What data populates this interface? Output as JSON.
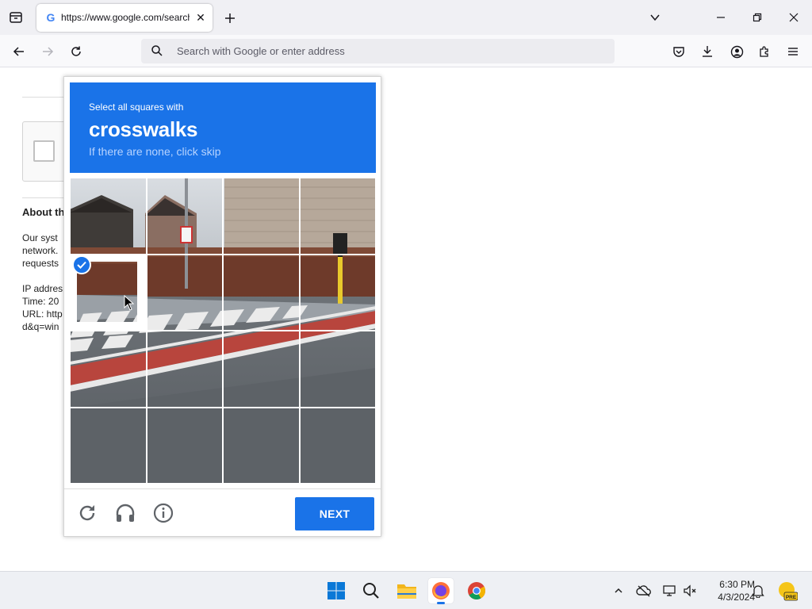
{
  "browser": {
    "tab": {
      "favicon": "G",
      "title": "https://www.google.com/search",
      "close_icon": "close-icon"
    },
    "new_tab_icon": "plus-icon",
    "urlbar": {
      "placeholder": "Search with Google or enter address",
      "icon": "search-icon"
    },
    "window_controls": [
      "minimize-icon",
      "restore-icon",
      "close-icon"
    ],
    "toolbar_icons": [
      "pocket-icon",
      "download-icon",
      "account-icon",
      "extensions-icon",
      "menu-icon"
    ]
  },
  "page": {
    "about_title": "About th",
    "para_lines": [
      "Our syst",
      "network.",
      "requests"
    ],
    "info_lines": [
      "IP addres",
      "Time: 20",
      "URL: http",
      "d&q=win"
    ]
  },
  "captcha": {
    "instruction": "Select all squares with",
    "target": "crosswalks",
    "hint": "If there are none, click skip",
    "grid": {
      "rows": 4,
      "cols": 4,
      "selected": [
        [
          1,
          0
        ]
      ]
    },
    "footer": {
      "reload_icon": "reload-icon",
      "audio_icon": "headphones-icon",
      "info_icon": "info-icon",
      "next_label": "NEXT"
    },
    "colors": {
      "header": "#1a73e8",
      "button": "#1a73e8",
      "hint": "#b7d3ff"
    }
  },
  "taskbar": {
    "apps": [
      "windows-start-icon",
      "search-icon",
      "file-explorer-icon",
      "firefox-icon",
      "chrome-icon"
    ],
    "active_app": "firefox-icon",
    "tray_icons": [
      "chevron-up-icon",
      "onedrive-icon",
      "network-icon",
      "volume-icon",
      "notification-icon",
      "widget-icon"
    ],
    "widget_badge": "PRE",
    "time": "6:30 PM",
    "date": "4/3/2024"
  }
}
